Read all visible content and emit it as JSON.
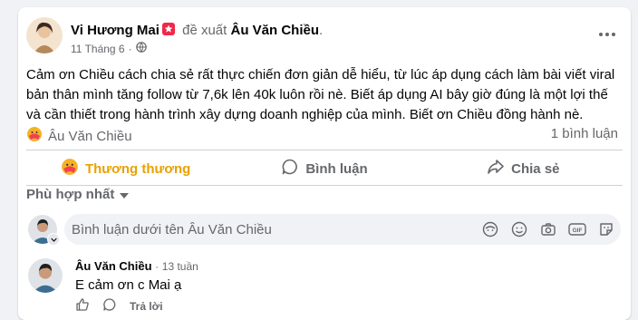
{
  "post": {
    "author": "Vi Hương Mai",
    "verb": "đề xuất",
    "target": "Âu Văn Chiều",
    "target_suffix": ".",
    "date": "11 Tháng 6",
    "separator": "·",
    "privacy_icon": "globe-icon",
    "text": "Cảm ơn Chiều cách chia sẻ rất thực chiến đơn giản dễ hiểu, từ lúc áp dụng cách làm bài viết viral bản thân mình tăng follow từ 7,6k lên 40k luôn rồi nè. Biết áp dụng AI bây giờ đúng là một lợi thế và cần thiết trong hành trình xây dựng doanh nghiệp của mình. Biết ơn Chiều đồng hành nè.",
    "reaction_name": "Âu Văn Chiều",
    "comment_count": "1 bình luận"
  },
  "actions": {
    "react": "Thương thương",
    "comment": "Bình luận",
    "share": "Chia sẻ"
  },
  "sort_label": "Phù hợp nhất",
  "compose": {
    "placeholder": "Bình luận dưới tên Âu Văn Chiều"
  },
  "comment": {
    "author": "Âu Văn Chiều",
    "time": "13 tuần",
    "separator": "·",
    "text": "E cảm ơn c Mai ạ",
    "reply_label": "Trả lời"
  },
  "colors": {
    "accent_react": "#e8a100",
    "muted": "#65676b",
    "background": "#f0f2f5"
  }
}
